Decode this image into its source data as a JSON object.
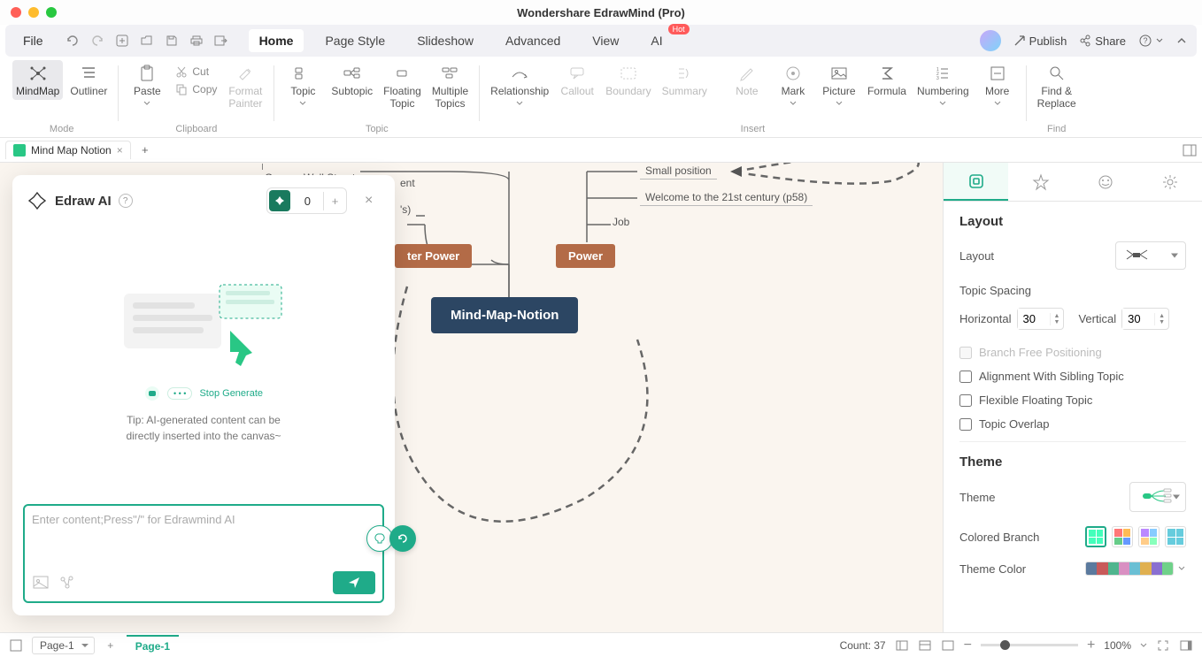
{
  "window": {
    "title": "Wondershare EdrawMind (Pro)"
  },
  "menu": {
    "file": "File",
    "tabs": [
      "Home",
      "Page Style",
      "Slideshow",
      "Advanced",
      "View",
      "AI"
    ],
    "hot_badge": "Hot",
    "publish": "Publish",
    "share": "Share"
  },
  "ribbon": {
    "mindmap": "MindMap",
    "outliner": "Outliner",
    "mode_label": "Mode",
    "paste": "Paste",
    "cut": "Cut",
    "copy": "Copy",
    "format_painter": "Format\nPainter",
    "clipboard_label": "Clipboard",
    "topic": "Topic",
    "subtopic": "Subtopic",
    "floating_topic": "Floating\nTopic",
    "multiple_topics": "Multiple\nTopics",
    "topic_label": "Topic",
    "relationship": "Relationship",
    "callout": "Callout",
    "boundary": "Boundary",
    "summary": "Summary",
    "note": "Note",
    "mark": "Mark",
    "picture": "Picture",
    "formula": "Formula",
    "numbering": "Numbering",
    "more": "More",
    "insert_label": "Insert",
    "find_replace": "Find &\nReplace",
    "find_label": "Find"
  },
  "doc_tab": {
    "name": "Mind Map Notion"
  },
  "canvas": {
    "occupy": "Occupy Wall Street",
    "partial_ent": "ent",
    "partial_s": "'s)",
    "ter_power": "ter Power",
    "power": "Power",
    "central": "Mind-Map-Notion",
    "small_position": "Small position",
    "welcome": "Welcome to the 21st century (p58)",
    "job": "Job"
  },
  "ai": {
    "title": "Edraw AI",
    "count": "0",
    "stop": "Stop Generate",
    "tip1": "Tip: AI-generated content can be",
    "tip2": "directly inserted into the canvas~",
    "placeholder": "Enter content;Press\"/\" for Edrawmind AI"
  },
  "rpanel": {
    "layout_title": "Layout",
    "layout_label": "Layout",
    "topic_spacing": "Topic Spacing",
    "horizontal": "Horizontal",
    "vertical": "Vertical",
    "h_val": "30",
    "v_val": "30",
    "branch_free": "Branch Free Positioning",
    "alignment": "Alignment With Sibling Topic",
    "flexible": "Flexible Floating Topic",
    "overlap": "Topic Overlap",
    "theme_title": "Theme",
    "theme_label": "Theme",
    "colored_branch": "Colored Branch",
    "theme_color": "Theme Color"
  },
  "footer": {
    "page_sel": "Page-1",
    "page_tab": "Page-1",
    "count": "Count: 37",
    "zoom": "100%"
  }
}
